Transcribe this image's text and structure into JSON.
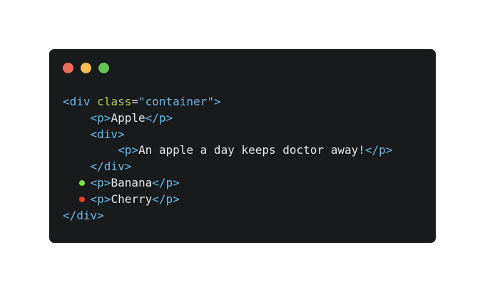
{
  "window": {
    "background": "#191a1c",
    "controls": [
      {
        "name": "close",
        "color": "#ed6a5e"
      },
      {
        "name": "minimize",
        "color": "#f5bf4f"
      },
      {
        "name": "maximize",
        "color": "#61c554"
      }
    ]
  },
  "colors": {
    "tag": "#6cb8e6",
    "attribute": "#b5cc57",
    "text": "#e7e7e7",
    "marker_added": "#7be042",
    "marker_removed": "#e53f2b"
  },
  "code": {
    "lines": [
      {
        "indent": "",
        "parts": [
          {
            "cls": "tag",
            "t": "<div "
          },
          {
            "cls": "attr",
            "t": "class"
          },
          {
            "cls": "eq",
            "t": "="
          },
          {
            "cls": "str",
            "t": "\"container\""
          },
          {
            "cls": "tag",
            "t": ">"
          }
        ]
      },
      {
        "indent": "    ",
        "parts": [
          {
            "cls": "tag",
            "t": "<p>"
          },
          {
            "cls": "text",
            "t": "Apple"
          },
          {
            "cls": "tag",
            "t": "</p>"
          }
        ]
      },
      {
        "indent": "    ",
        "parts": [
          {
            "cls": "tag",
            "t": "<div>"
          }
        ]
      },
      {
        "indent": "        ",
        "parts": [
          {
            "cls": "tag",
            "t": "<p>"
          },
          {
            "cls": "text",
            "t": "An apple a day keeps doctor away!"
          },
          {
            "cls": "tag",
            "t": "</p>"
          }
        ]
      },
      {
        "indent": "    ",
        "parts": [
          {
            "cls": "tag",
            "t": "</div>"
          }
        ]
      },
      {
        "indent": "    ",
        "marker": "added",
        "parts": [
          {
            "cls": "tag",
            "t": "<p>"
          },
          {
            "cls": "text",
            "t": "Banana"
          },
          {
            "cls": "tag",
            "t": "</p>"
          }
        ]
      },
      {
        "indent": "    ",
        "marker": "removed",
        "parts": [
          {
            "cls": "tag",
            "t": "<p>"
          },
          {
            "cls": "text",
            "t": "Cherry"
          },
          {
            "cls": "tag",
            "t": "</p>"
          }
        ]
      },
      {
        "indent": "",
        "parts": [
          {
            "cls": "tag",
            "t": "</div>"
          }
        ]
      }
    ]
  }
}
